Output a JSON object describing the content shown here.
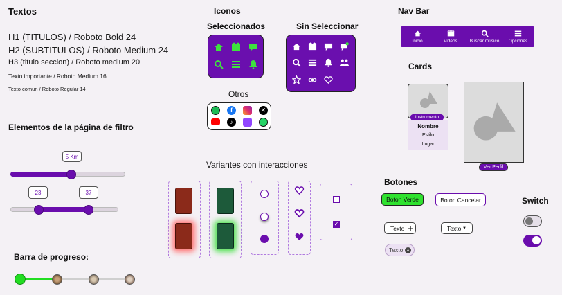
{
  "textos": {
    "title": "Textos",
    "h1": "H1 (TITULOS) / Roboto Bold 24",
    "h2": "H2 (SUBTITULOS) / Roboto Medium 24",
    "h3": "H3 (titulo seccion) / Roboto medium 20",
    "important": "Texto importante / Roboto Medium 16",
    "common": "Texto comun / Roboto Regular 14"
  },
  "filtro": {
    "title": "Elementos de la página de filtro",
    "single_value_label": "5 Km",
    "range_min_label": "23",
    "range_max_label": "37"
  },
  "progreso": {
    "title": "Barra de progreso:"
  },
  "iconos": {
    "title": "Iconos",
    "selected_title": "Seleccionados",
    "unselected_title": "Sin Seleccionar",
    "others_title": "Otros"
  },
  "variantes": {
    "title": "Variantes con interacciones"
  },
  "navbar": {
    "title": "Nav Bar",
    "items": [
      {
        "label": "Inicio",
        "icon": "home-icon"
      },
      {
        "label": "Videos",
        "icon": "video-icon"
      },
      {
        "label": "Buscar músico",
        "icon": "search-icon"
      },
      {
        "label": "Opciones",
        "icon": "menu-icon"
      }
    ]
  },
  "cards": {
    "title": "Cards",
    "tag": "Instrumento",
    "name": "Nombre",
    "style": "Estilo",
    "place": "Lugar",
    "profile_button": "Ver Perfil"
  },
  "botones": {
    "title": "Botones",
    "green": "Boton Verde",
    "cancel": "Boton Cancelar",
    "text_add": "Texto",
    "text_dropdown": "Texto",
    "chip": "Texto"
  },
  "switch": {
    "title": "Switch"
  },
  "colors": {
    "brand_purple": "#6a0dad",
    "green": "#22dd22",
    "red_glow": "#ff7a7a",
    "green_glow": "#5be35b"
  }
}
